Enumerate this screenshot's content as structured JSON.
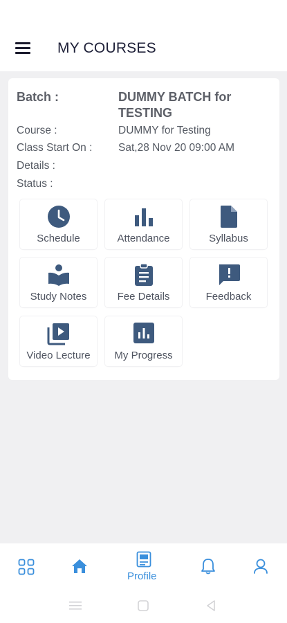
{
  "header": {
    "title": "MY COURSES",
    "menu_icon": "hamburger-menu-icon"
  },
  "course_card": {
    "batch_label": "Batch :",
    "batch_value": "DUMMY BATCH for TESTING",
    "course_label": "Course :",
    "course_value": "DUMMY for Testing",
    "class_start_label": "Class Start On :",
    "class_start_value": "Sat,28 Nov 20 09:00 AM",
    "details_label": "Details :",
    "status_label": "Status :"
  },
  "tiles": [
    {
      "label": "Schedule",
      "icon": "clock-icon"
    },
    {
      "label": "Attendance",
      "icon": "bar-chart-icon"
    },
    {
      "label": "Syllabus",
      "icon": "document-icon"
    },
    {
      "label": "Study Notes",
      "icon": "reader-book-icon"
    },
    {
      "label": "Fee Details",
      "icon": "clipboard-icon"
    },
    {
      "label": "Feedback",
      "icon": "feedback-icon"
    },
    {
      "label": "Video Lecture",
      "icon": "video-library-icon"
    },
    {
      "label": "My Progress",
      "icon": "progress-chart-icon"
    }
  ],
  "bottom_nav": {
    "items": [
      {
        "name": "apps",
        "icon": "grid-icon"
      },
      {
        "name": "home",
        "icon": "home-icon"
      },
      {
        "name": "profile",
        "label": "Profile",
        "icon": "profile-card-icon"
      },
      {
        "name": "notifications",
        "icon": "bell-icon"
      },
      {
        "name": "account",
        "icon": "user-icon"
      }
    ]
  },
  "colors": {
    "accent": "#3a8fdc",
    "tile_icon": "#3e5a7e",
    "title": "#1f2139",
    "background": "#f0f0f2"
  }
}
